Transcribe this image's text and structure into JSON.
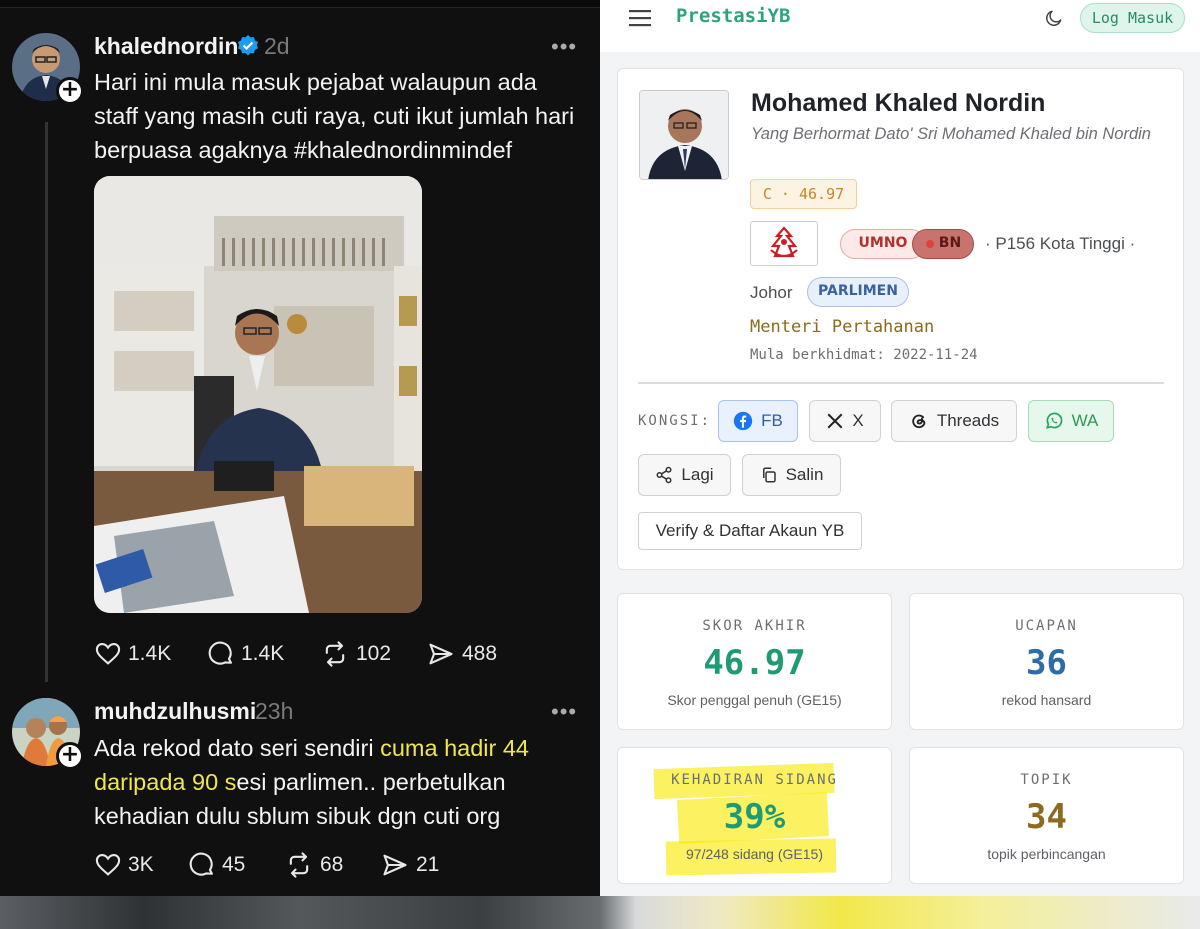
{
  "threads": {
    "post1": {
      "username": "khalednordin",
      "time": "2d",
      "text": "Hari ini mula masuk pejabat walaupun ada staff yang masih cuti raya, cuti ikut jumlah hari berpuasa agaknya #khalednordinmindef",
      "likes": "1.4K",
      "replies": "1.4K",
      "reposts": "102",
      "shares": "488",
      "photo_icons": [
        "office-desk-photo"
      ]
    },
    "post2": {
      "username": "muhdzulhusmi",
      "time": "23h",
      "text_before": "Ada rekod dato seri sendiri ",
      "text_highlight": "cuma hadir 44 daripada 90 s",
      "text_after": "esi parlimen.. perbetulkan kehadian dulu sblum sibuk dgn cuti org",
      "likes": "3K",
      "replies": "45",
      "reposts": "68",
      "shares": "21"
    },
    "more_label": "•••"
  },
  "prestasi": {
    "brand": "PrestasiYB",
    "login_label": "Log Masuk",
    "profile": {
      "name": "Mohamed Khaled Nordin",
      "title": "Yang Berhormat Dato' Sri Mohamed Khaled bin Nordin",
      "grade": "C · 46.97",
      "party": "UMNO",
      "coalition": "BN",
      "seat": "· P156 Kota Tinggi ·",
      "state": "Johor",
      "house": "PARLIMEN",
      "role": "Menteri Pertahanan",
      "since": "Mula berkhidmat: 2022-11-24"
    },
    "share": {
      "label": "KONGSI:",
      "fb": "FB",
      "x": "X",
      "threads": "Threads",
      "wa": "WA",
      "more": "Lagi",
      "copy": "Salin",
      "verify": "Verify & Daftar Akaun YB"
    },
    "stats": [
      {
        "label": "SKOR AKHIR",
        "value": "46.97",
        "sub": "Skor penggal penuh (GE15)",
        "color": "#1f9a74"
      },
      {
        "label": "UCAPAN",
        "value": "36",
        "sub": "rekod hansard",
        "color": "#2e6ca8"
      },
      {
        "label": "KEHADIRAN SIDANG",
        "value": "39%",
        "sub": "97/248 sidang (GE15)",
        "color": "#1f9a74"
      },
      {
        "label": "TOPIK",
        "value": "34",
        "sub": "topik perbincangan",
        "color": "#8c6a1e"
      }
    ],
    "colors": {
      "accent": "#2ea37e",
      "highlight": "#f8e800"
    }
  }
}
